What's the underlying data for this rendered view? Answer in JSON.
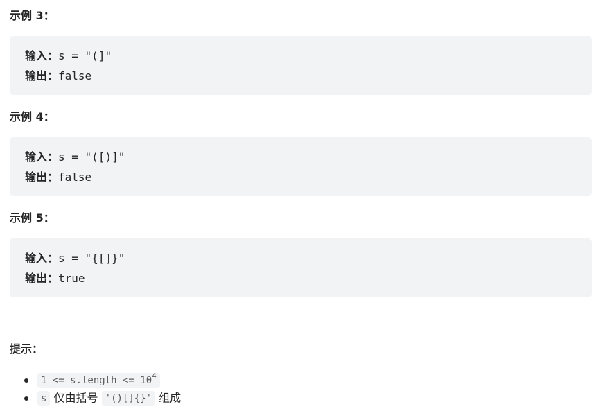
{
  "examples": [
    {
      "heading": "示例 3：",
      "input_label": "输入：",
      "input_value": "s = \"(]\"",
      "output_label": "输出：",
      "output_value": "false"
    },
    {
      "heading": "示例 4：",
      "input_label": "输入：",
      "input_value": "s = \"([)]\"",
      "output_label": "输出：",
      "output_value": "false"
    },
    {
      "heading": "示例 5：",
      "input_label": "输入：",
      "input_value": "s = \"{[]}\"",
      "output_label": "输出：",
      "output_value": "true"
    }
  ],
  "hints": {
    "heading": "提示：",
    "item1_code": "1 <= s.length <= 10",
    "item1_exponent": "4",
    "item2_code_s": "s",
    "item2_text": "仅由括号",
    "item2_code_brackets": "'()[]{}'",
    "item2_suffix": "组成"
  }
}
